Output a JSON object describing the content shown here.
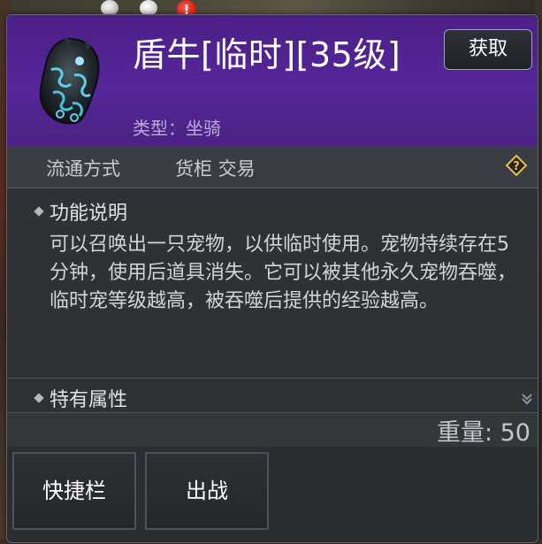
{
  "item": {
    "name": "盾牛[临时][35级]",
    "type_text": "类型：坐骑",
    "obtain_label": "获取"
  },
  "trade": {
    "label": "流通方式",
    "values": "货柜 交易"
  },
  "description": {
    "title": "功能说明",
    "text": "可以召唤出一只宠物，以供临时使用。宠物持续存在5分钟，使用后道具消失。它可以被其他永久宠物吞噬，临时宠等级越高，被吞噬后提供的经验越高。"
  },
  "attributes": {
    "title": "特有属性"
  },
  "weight": {
    "text": "重量: 50"
  },
  "actions": {
    "shortcut_label": "快捷栏",
    "deploy_label": "出战"
  },
  "markers": {
    "alert_symbol": "!"
  },
  "colors": {
    "header_purple": "#56269a",
    "panel_bg": "#2e3237",
    "help_icon_gold": "#e3c24a",
    "alert_red": "#d8221a"
  },
  "icons": {
    "item": "beast-head-icon",
    "help": "help-diamond-icon",
    "expand": "double-chevron-down-icon"
  }
}
